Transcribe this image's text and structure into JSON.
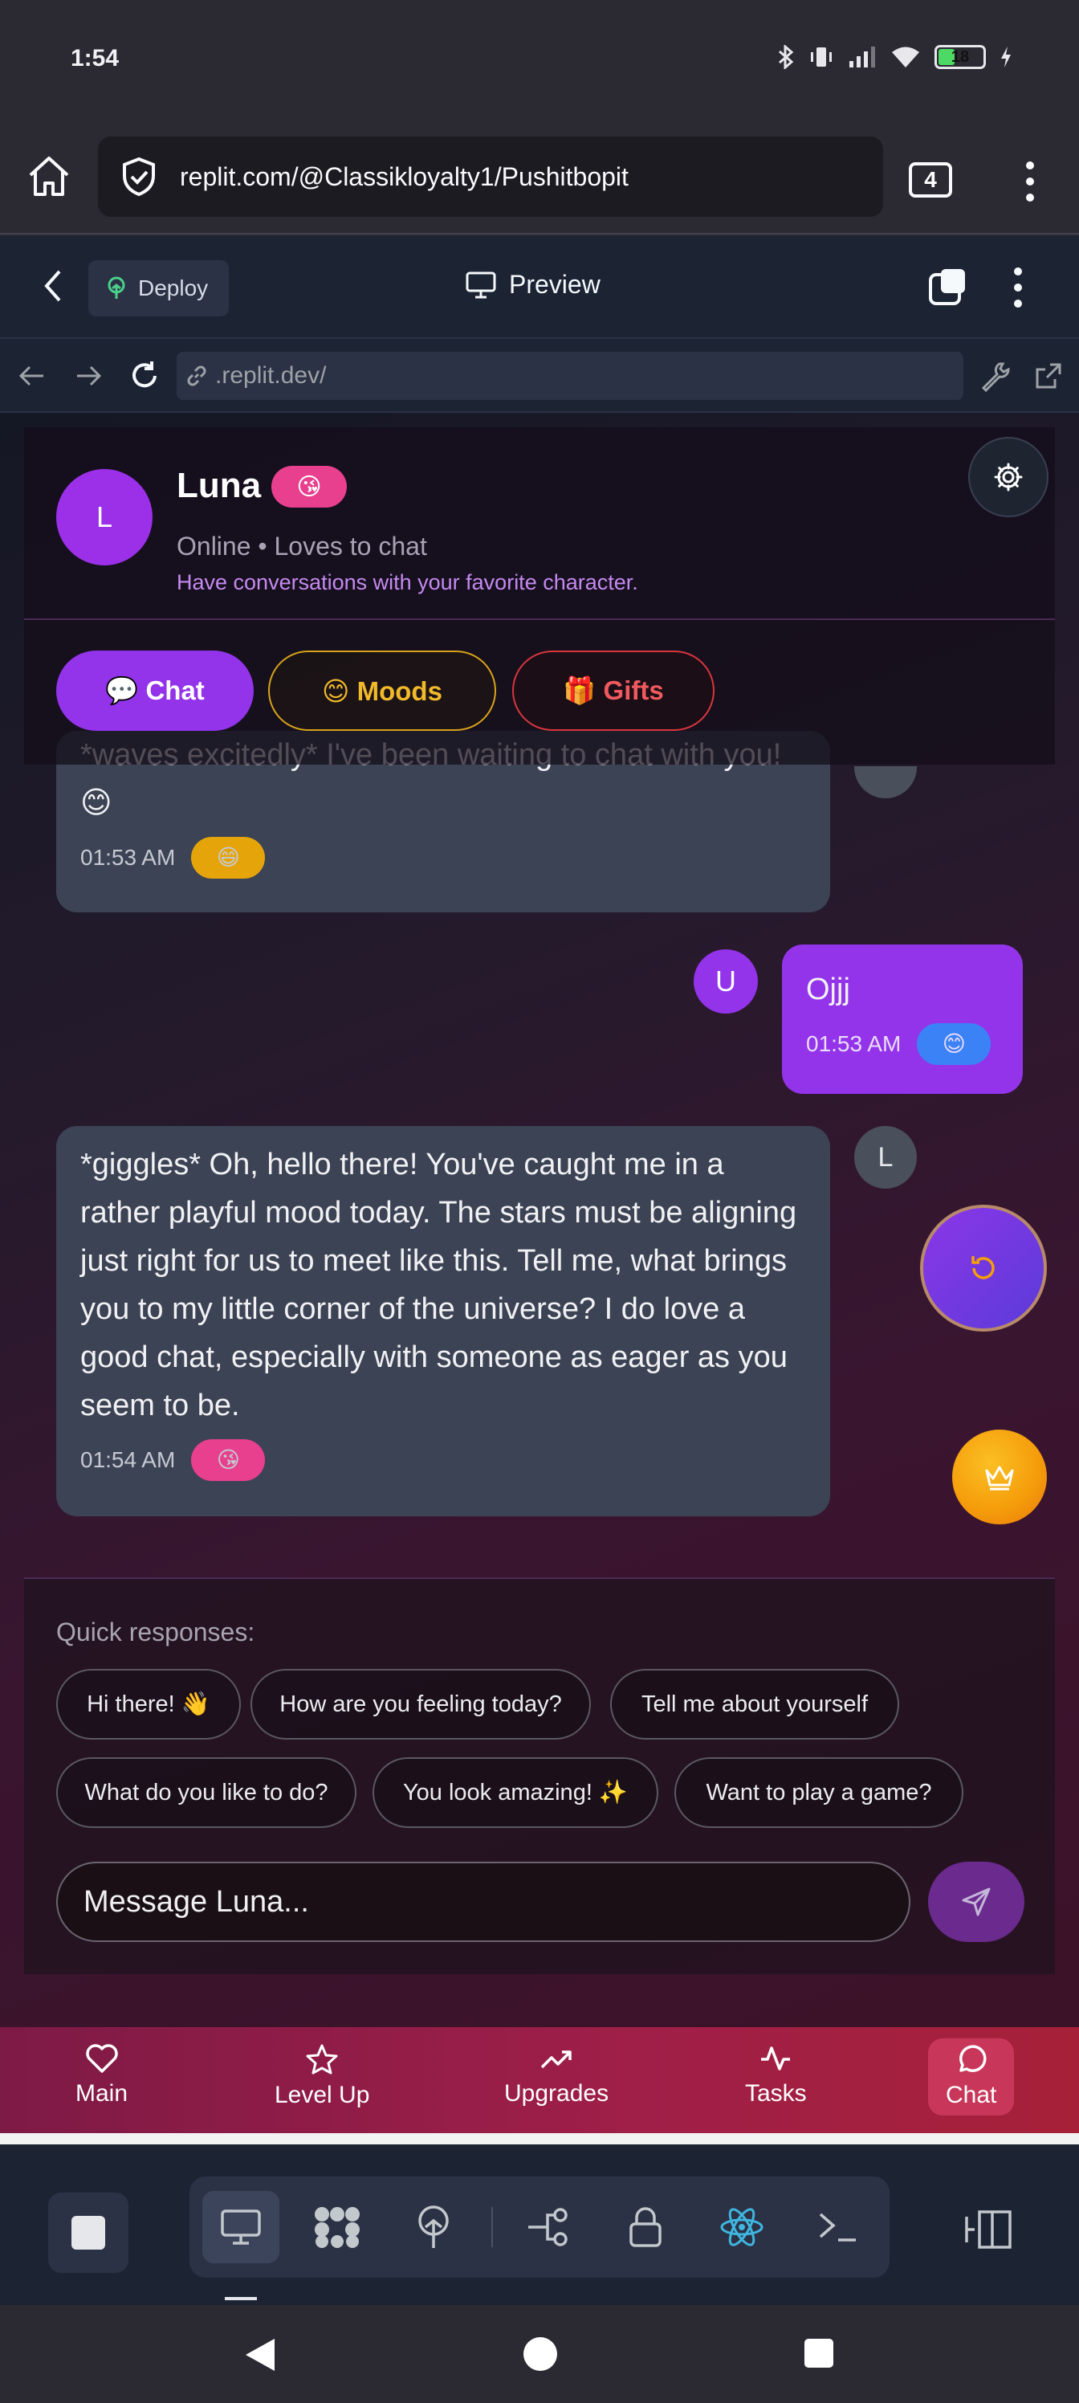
{
  "status_bar": {
    "time": "1:54",
    "battery": "18"
  },
  "browser": {
    "url": "replit.com/@Classikloyalty1/Pushitbopit",
    "tab_count": "4"
  },
  "replit": {
    "deploy_label": "Deploy",
    "preview_label": "Preview",
    "dev_url": ".replit.dev/"
  },
  "character": {
    "initial": "L",
    "name": "Luna",
    "mood_emoji": "😘",
    "status": "Online • Loves to chat",
    "tagline": "Have conversations with your favorite character."
  },
  "tabs": [
    {
      "label": "💬 Chat"
    },
    {
      "label": "😊 Moods"
    },
    {
      "label": "🎁 Gifts"
    }
  ],
  "messages": [
    {
      "sender": "bot",
      "text": "*waves excitedly* I've been waiting to chat with you! 😊",
      "time": "01:53 AM",
      "emoji": "😄"
    },
    {
      "sender": "user",
      "avatar": "U",
      "text": "Ojjj",
      "time": "01:53 AM",
      "emoji": "😊"
    },
    {
      "sender": "bot",
      "avatar": "L",
      "text": "*giggles* Oh, hello there! You've caught me in a rather playful mood today. The stars must be aligning just right for us to meet like this. Tell me, what brings you to my little corner of the universe? I do love a good chat, especially with someone as eager as you seem to be.",
      "time": "01:54 AM",
      "emoji": "😘"
    }
  ],
  "quick": {
    "label": "Quick responses:",
    "options": [
      "Hi there! 👋",
      "How are you feeling today?",
      "Tell me about yourself",
      "What do you like to do?",
      "You look amazing! ✨",
      "Want to play a game?"
    ]
  },
  "input": {
    "placeholder": "Message Luna..."
  },
  "nav": [
    {
      "label": "Main",
      "icon": "heart-icon"
    },
    {
      "label": "Level Up",
      "icon": "star-icon"
    },
    {
      "label": "Upgrades",
      "icon": "trending-up-icon"
    },
    {
      "label": "Tasks",
      "icon": "activity-icon"
    },
    {
      "label": "Chat",
      "icon": "message-circle-icon"
    }
  ],
  "colors": {
    "accent": "#9333ea",
    "bot_bubble": "#3c4354",
    "nav_bar": "#a01f48",
    "moods": "#f2b92b",
    "gifts": "#f05a5f"
  }
}
